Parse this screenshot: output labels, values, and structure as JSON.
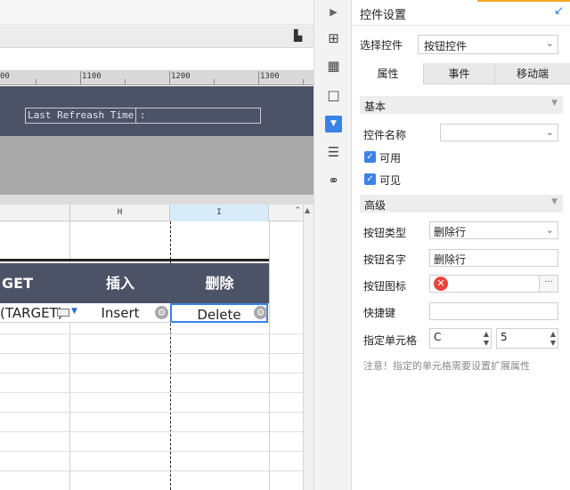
{
  "ruler": {
    "marks": [
      "00",
      "1100",
      "1200",
      "1300"
    ]
  },
  "report": {
    "refresh_label": "Last Refreash Time :"
  },
  "grid": {
    "col_headers": [
      "H",
      "I"
    ],
    "header_cells": [
      "GET",
      "插入",
      "删除"
    ],
    "data_cells": [
      "(TARGET)",
      "Insert",
      "Delete"
    ]
  },
  "panel": {
    "title": "控件设置",
    "select_label": "选择控件",
    "select_value": "按钮控件",
    "tabs": [
      "属性",
      "事件",
      "移动端"
    ],
    "sections": {
      "basic": "基本",
      "advanced": "高级"
    },
    "fields": {
      "control_name_label": "控件名称",
      "control_name_value": "",
      "enabled_label": "可用",
      "visible_label": "可见",
      "button_type_label": "按钮类型",
      "button_type_value": "删除行",
      "button_name_label": "按钮名字",
      "button_name_value": "删除行",
      "button_icon_label": "按钮图标",
      "hotkey_label": "快捷键",
      "hotkey_value": "",
      "cell_label": "指定单元格",
      "cell_col": "C",
      "cell_row": "5"
    },
    "note": "注意！指定的单元格需要设置扩展属性"
  },
  "colors": {
    "accent": "#3b82e6",
    "header_band": "#4c5367",
    "error": "#e8453c",
    "highlight": "#f5a623"
  },
  "icons": [
    "expand-icon",
    "layout-icon",
    "table-icon",
    "frame-icon",
    "widget-icon",
    "stack-icon",
    "link-icon",
    "collapse-icon",
    "gear-icon",
    "error-icon",
    "format-icon"
  ]
}
